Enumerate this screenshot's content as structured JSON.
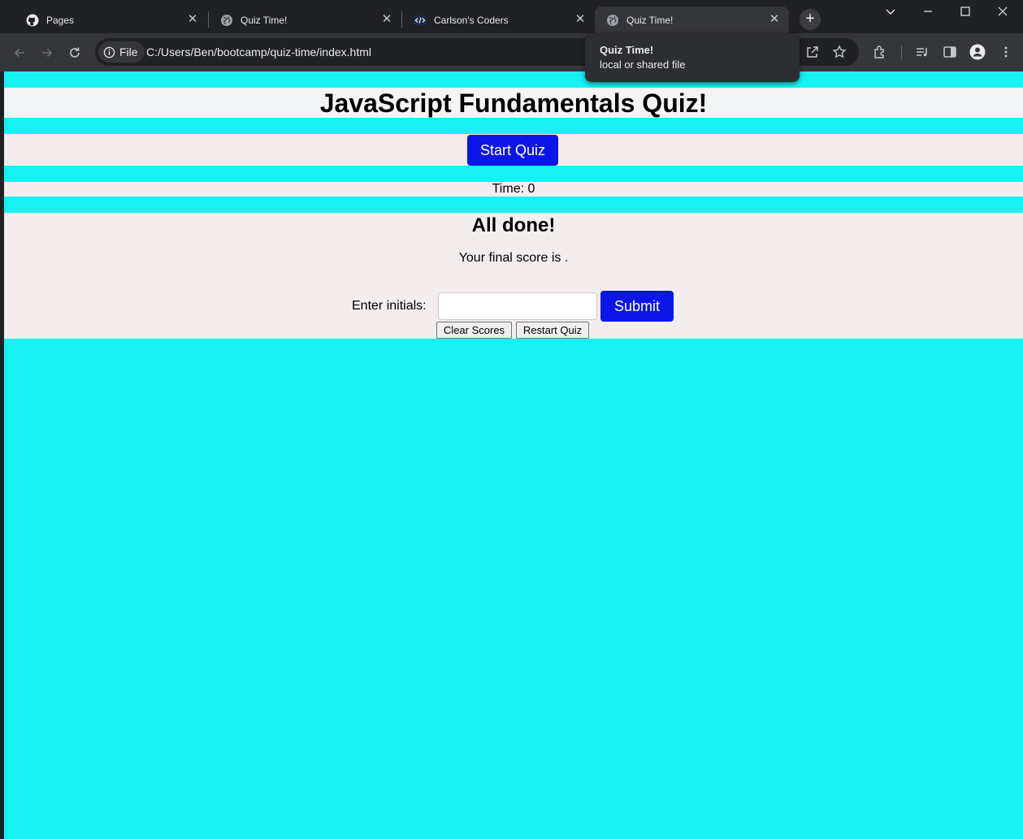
{
  "browser": {
    "tabs": [
      {
        "title": "Pages",
        "icon": "github-icon"
      },
      {
        "title": "Quiz Time!",
        "icon": "globe-icon"
      },
      {
        "title": "Carlson's Coders",
        "icon": "code-icon"
      },
      {
        "title": "Quiz Time!",
        "icon": "globe-icon",
        "active": true
      }
    ],
    "close_glyph": "✕",
    "new_tab_glyph": "+",
    "site_info_label": "File",
    "url": "C:/Users/Ben/bootcamp/quiz-time/index.html",
    "hover_card": {
      "title": "Quiz Time!",
      "subtitle": "local or shared file"
    }
  },
  "page": {
    "title": "JavaScript Fundamentals Quiz!",
    "start_button": "Start Quiz",
    "timer": "Time: 0",
    "done_title": "All done!",
    "final_score": "Your final score is .",
    "initials_label": "Enter initials:",
    "initials_value": "",
    "submit_button": "Submit",
    "clear_button": "Clear Scores",
    "restart_button": "Restart Quiz"
  },
  "colors": {
    "page_background": "#17f1f1",
    "band_background": "#f3eded",
    "accent_button": "#0b16e6"
  }
}
